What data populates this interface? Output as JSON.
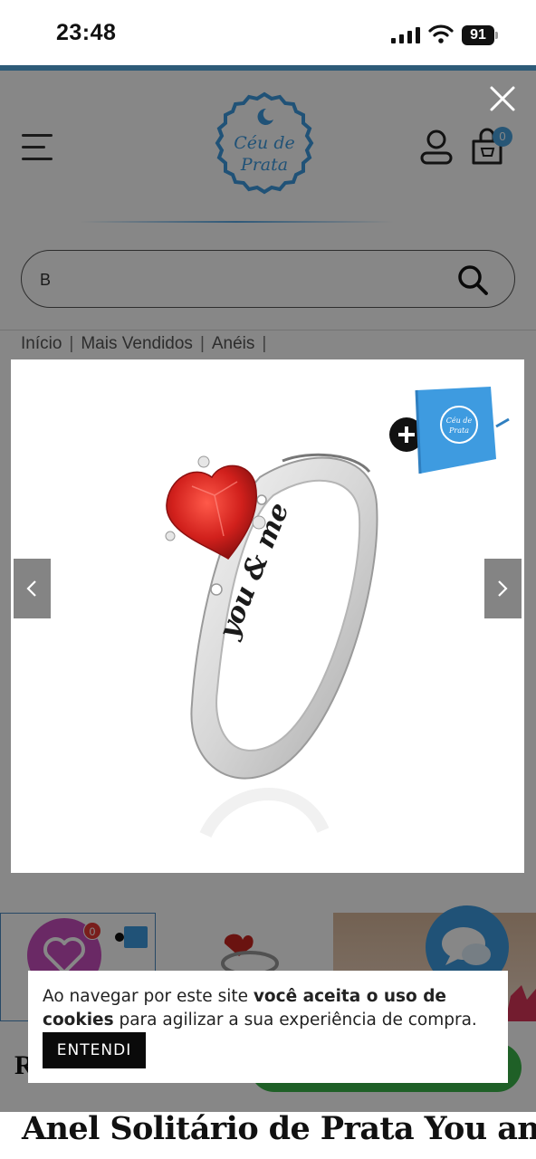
{
  "status_bar": {
    "time": "23:48",
    "battery": "91"
  },
  "header": {
    "logo_text_line1": "Céu de",
    "logo_text_line2": "Prata",
    "cart_count": "0"
  },
  "search": {
    "value": "B"
  },
  "breadcrumb": [
    "Início",
    "Mais Vendidos",
    "Anéis"
  ],
  "gallery": {
    "box_logo_line1": "Céu de",
    "box_logo_line2": "Prata",
    "engraving": "you & me"
  },
  "wishlist_count": "0",
  "product": {
    "title_partial": "Anel Solitário de Prata You and",
    "section_letter": "R"
  },
  "cookie": {
    "text_before": "Ao navegar por este site ",
    "text_bold": "você aceita o uso de cookies",
    "text_after": " para agilizar a sua experiência de compra.",
    "button": "ENTENDI"
  },
  "colors": {
    "brand_blue": "#3e9be0",
    "top_bar": "#2d5b78",
    "cta_green": "#3cb54a",
    "ruby": "#d1201c"
  },
  "icons": [
    "signal-icon",
    "wifi-icon",
    "battery-icon",
    "menu-icon",
    "user-icon",
    "cart-icon",
    "search-icon",
    "close-icon",
    "chevron-left-icon",
    "chevron-right-icon",
    "plus-icon",
    "heart-icon",
    "chat-icon"
  ]
}
